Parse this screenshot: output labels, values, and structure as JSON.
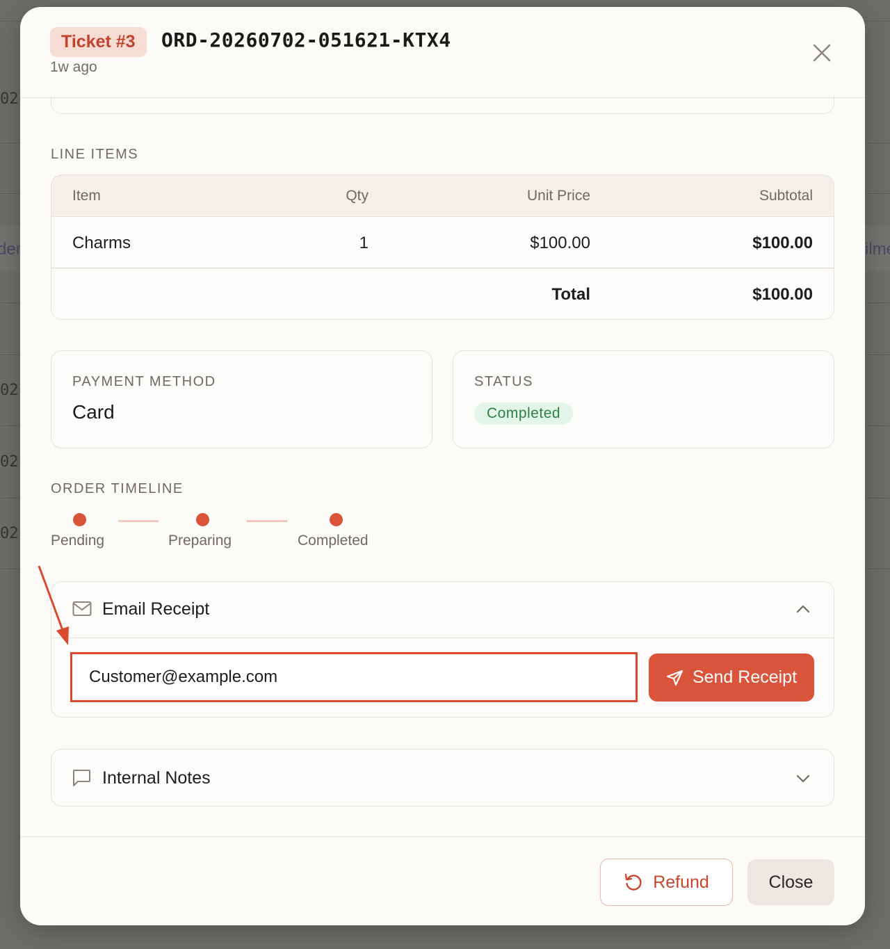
{
  "background": {
    "fragments": [
      "02",
      "der",
      "02",
      "02",
      "02",
      "ilme"
    ]
  },
  "modal": {
    "ticket_badge": "Ticket #3",
    "order_id": "ORD-20260702-051621-KTX4",
    "time_ago": "1w ago",
    "close_icon": "close-icon"
  },
  "line_items": {
    "section_label": "LINE ITEMS",
    "headers": {
      "item": "Item",
      "qty": "Qty",
      "unit_price": "Unit Price",
      "subtotal": "Subtotal"
    },
    "rows": [
      {
        "item": "Charms",
        "qty": "1",
        "unit_price": "$100.00",
        "subtotal": "$100.00"
      }
    ],
    "total_label": "Total",
    "total_value": "$100.00"
  },
  "payment": {
    "label": "PAYMENT METHOD",
    "value": "Card"
  },
  "status": {
    "label": "STATUS",
    "value": "Completed",
    "color": "#2f7f45"
  },
  "timeline": {
    "section_label": "ORDER TIMELINE",
    "steps": [
      "Pending",
      "Preparing",
      "Completed"
    ]
  },
  "email_receipt": {
    "title": "Email Receipt",
    "icon": "mail-icon",
    "expanded": true,
    "email_value": "Customer@example.com",
    "send_label": "Send Receipt"
  },
  "internal_notes": {
    "title": "Internal Notes",
    "icon": "chat-bubble-icon",
    "expanded": false
  },
  "footer": {
    "refund_label": "Refund",
    "close_label": "Close"
  },
  "colors": {
    "accent": "#d9543a",
    "annotation": "#db4a2f"
  }
}
